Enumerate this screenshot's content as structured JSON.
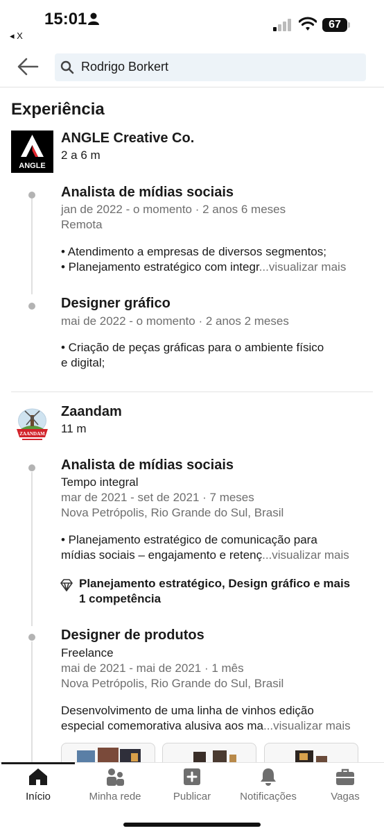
{
  "status": {
    "time": "15:01",
    "back_app": "◂ X",
    "battery": "67"
  },
  "search": {
    "value": "Rodrigo Borkert"
  },
  "section": {
    "title": "Experiência"
  },
  "companies": [
    {
      "name": "ANGLE Creative Co.",
      "duration": "2 a 6 m",
      "logo_text": "ANGLE",
      "roles": [
        {
          "title": "Analista de mídias sociais",
          "dates": "jan de 2022 - o momento · 2 anos 6 meses",
          "location": "Remota",
          "desc_line1": "• Atendimento a empresas de diversos segmentos;",
          "desc_line2": "• Planejamento estratégico com integr",
          "more": "...visualizar mais"
        },
        {
          "title": "Designer gráfico",
          "dates": "mai de 2022 - o momento · 2 anos 2 meses",
          "desc_line1": "• Criação de peças gráficas para o ambiente físico",
          "desc_line2": "e digital;"
        }
      ]
    },
    {
      "name": "Zaandam",
      "duration": "11 m",
      "logo_text": "ZAANDAM",
      "roles": [
        {
          "title": "Analista de mídias sociais",
          "type": "Tempo integral",
          "dates": "mar de 2021 - set de 2021 · 7 meses",
          "location": "Nova Petrópolis, Rio Grande do Sul, Brasil",
          "desc_line1": "• Planejamento estratégico de comunicação para",
          "desc_line2": "mídias sociais – engajamento e retenç",
          "more": "...visualizar mais",
          "skills_line1": "Planejamento estratégico, Design gráfico e mais",
          "skills_line2": "1 competência"
        },
        {
          "title": "Designer de produtos",
          "type": "Freelance",
          "dates": "mai de 2021 - mai de 2021 · 1 mês",
          "location": "Nova Petrópolis, Rio Grande do Sul, Brasil",
          "desc_line1": "Desenvolvimento de uma linha de vinhos edição",
          "desc_line2": "especial comemorativa alusiva aos ma",
          "more": "...visualizar mais"
        }
      ]
    }
  ],
  "tabs": [
    {
      "label": "Início",
      "icon": "home-icon",
      "active": true
    },
    {
      "label": "Minha rede",
      "icon": "network-icon",
      "active": false
    },
    {
      "label": "Publicar",
      "icon": "post-icon",
      "active": false
    },
    {
      "label": "Notificações",
      "icon": "bell-icon",
      "active": false
    },
    {
      "label": "Vagas",
      "icon": "briefcase-icon",
      "active": false
    }
  ]
}
